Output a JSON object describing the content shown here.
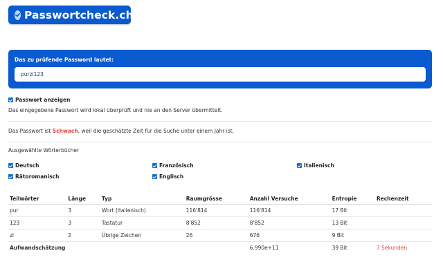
{
  "brand": {
    "name": "Passwortcheck.ch",
    "color": "#0a5ad0"
  },
  "password_card": {
    "label": "Das zu prüfende Password lautet:",
    "value": "purzi123",
    "placeholder": ""
  },
  "show_password": {
    "label": "Passwort anzeigen",
    "checked": true
  },
  "info_text": "Das eingegebene Passwort wird lokal überprüft und nie an den Server übermittelt.",
  "verdict": {
    "prefix": "Das Passwort ist ",
    "strength": "Schwach",
    "suffix": ", weil die geschätzte Zeit für die Suche unter einem Jahr ist.",
    "strength_color": "#e0453a"
  },
  "dictionaries": {
    "title": "Ausgewählte Wörterbücher",
    "items": [
      {
        "label": "Deutsch",
        "checked": true
      },
      {
        "label": "Französisch",
        "checked": true
      },
      {
        "label": "Italienisch",
        "checked": true
      },
      {
        "label": "Rätoromanisch",
        "checked": true
      },
      {
        "label": "Englisch",
        "checked": true
      }
    ]
  },
  "table": {
    "headers": [
      "Teilwörter",
      "Länge",
      "Typ",
      "Raumgrösse",
      "Anzahl Versuche",
      "Entropie",
      "Rechenzeit"
    ],
    "rows": [
      [
        "pur",
        "3",
        "Wort (Italienisch)",
        "116'814",
        "116'814",
        "17 Bit",
        ""
      ],
      [
        "123",
        "3",
        "Tastatur",
        "8'852",
        "8'852",
        "13 Bit",
        ""
      ],
      [
        "zi",
        "2",
        "Übrige Zeichen",
        "26",
        "676",
        "9 Bit",
        ""
      ]
    ],
    "summary": [
      "Aufwandschätzung",
      "",
      "",
      "",
      "6.990e+11",
      "39 Bit",
      "7 Sekunden"
    ]
  }
}
